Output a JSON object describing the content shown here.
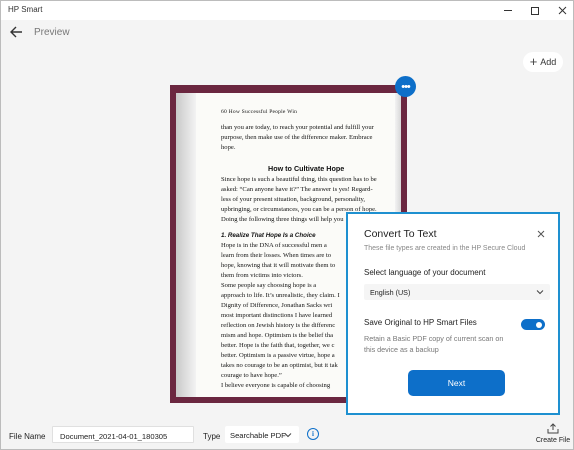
{
  "app": {
    "title": "HP Smart"
  },
  "window_controls": {
    "minimize_icon": "minimize-icon",
    "maximize_icon": "maximize-icon",
    "close_icon": "close-icon"
  },
  "nav": {
    "title": "Preview",
    "back_icon": "back-arrow-icon"
  },
  "toolbar": {
    "add_label": "Add"
  },
  "document": {
    "header": "60 How Successful People Win",
    "lines_top": [
      "than you are today, to reach your potential and fulfill your",
      "purpose, then make use of the difference maker. Embrace",
      "hope."
    ],
    "heading": "How to Cultivate Hope",
    "lines_mid": [
      "Since hope is such a beautiful thing, this question has to be",
      "asked: “Can anyone have it?” The answer is yes! Regard-",
      "less of your present situation, background, personality,",
      "upbringing, or circumstances, you can be a person of hope.",
      "Doing the following three things will help you"
    ],
    "subheading": "1. Realize That Hope Is a Choice",
    "lines_bottom": [
      "Hope is in the DNA of successful men a",
      "learn from their losses. When times are to",
      "hope, knowing that it will motivate them to",
      "them from victims into victors.",
      "   Some people say choosing hope is a",
      "approach to life. It’s unrealistic, they claim. I",
      "Dignity of Difference, Jonathan Sacks wri",
      "most important distinctions I have learned",
      "reflection on Jewish history is the differenc",
      "mism and hope. Optimism is the belief tha",
      "better. Hope is the faith that, together, we c",
      "better. Optimism is a passive virtue, hope a",
      "takes no courage to be an optimist, but it tak",
      "courage to have hope.”",
      "   I believe everyone is capable of choosing"
    ]
  },
  "modal": {
    "title": "Convert To Text",
    "subtitle": "These file types are created in the HP Secure Cloud",
    "language_label": "Select language of your document",
    "language_value": "English (US)",
    "save_label": "Save Original to HP Smart Files",
    "save_desc": "Retain a Basic PDF copy of current scan on this device as a backup",
    "save_enabled": true,
    "next_label": "Next"
  },
  "bottom": {
    "file_name_label": "File Name",
    "file_name_value": "Document_2021-04-01_180305",
    "type_label": "Type",
    "type_value": "Searchable PDF",
    "create_label": "Create File"
  },
  "colors": {
    "accent": "#0d6fc9",
    "modal_border": "#1e90d0",
    "frame": "#6b2740"
  }
}
